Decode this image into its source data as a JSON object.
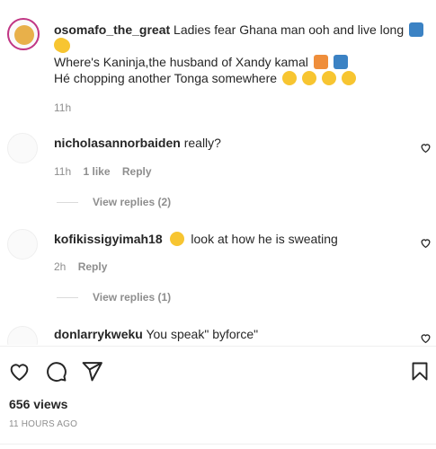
{
  "caption": {
    "username": "osomafo_the_great",
    "line1": "Ladies fear Ghana man ooh and live long",
    "line2": "Where's Kaninja,the husband of Xandy kamal",
    "line3": "Hé chopping another Tonga somewhere",
    "time": "11h"
  },
  "comments": [
    {
      "username": "nicholasannorbaiden",
      "text": "really?",
      "time": "11h",
      "likes": "1 like",
      "reply_label": "Reply",
      "view_replies": "View replies (2)"
    },
    {
      "username": "kofikissigyimah18",
      "text": "look at how he is sweating",
      "time": "2h",
      "reply_label": "Reply",
      "view_replies": "View replies (1)"
    },
    {
      "username": "donlarrykweku",
      "text": "You speak\" byforce\""
    }
  ],
  "footer": {
    "views": "656 views",
    "timestamp": "11 HOURS AGO"
  },
  "colors": {
    "text": "#262626",
    "muted": "#8e8e8e",
    "divider": "#efefef"
  }
}
